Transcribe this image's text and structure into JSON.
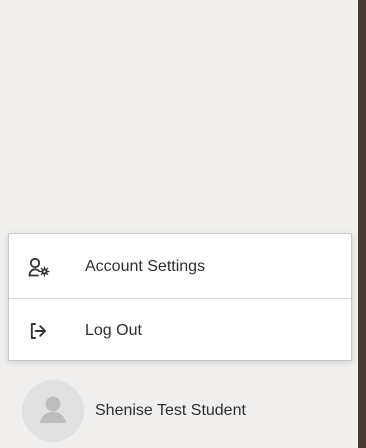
{
  "menu": {
    "items": [
      {
        "label": "Account Settings",
        "icon": "user-gear-icon"
      },
      {
        "label": "Log Out",
        "icon": "log-out-icon"
      }
    ]
  },
  "user": {
    "name": "Shenise Test Student",
    "avatar_icon": "user-avatar-icon"
  },
  "colors": {
    "panel_background": "#f0efed",
    "menu_background": "#ffffff",
    "menu_border": "#c9c9c9",
    "text": "#2f2f2f",
    "avatar_background": "#e1e1e1",
    "avatar_icon": "#bdbdbd",
    "right_edge": "#4a3a30"
  }
}
